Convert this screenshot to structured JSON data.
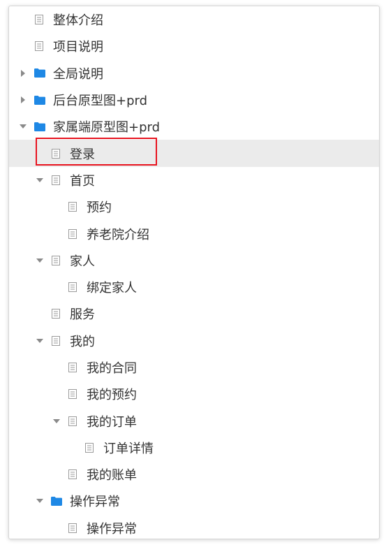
{
  "tree": {
    "items": [
      {
        "label": "整体介绍",
        "type": "page",
        "depth": 0,
        "expanded": null,
        "selected": false
      },
      {
        "label": "项目说明",
        "type": "page",
        "depth": 0,
        "expanded": null,
        "selected": false
      },
      {
        "label": "全局说明",
        "type": "folder",
        "depth": 0,
        "expanded": false,
        "selected": false
      },
      {
        "label": "后台原型图+prd",
        "type": "folder",
        "depth": 0,
        "expanded": false,
        "selected": false
      },
      {
        "label": "家属端原型图+prd",
        "type": "folder",
        "depth": 0,
        "expanded": true,
        "selected": false
      },
      {
        "label": "登录",
        "type": "page",
        "depth": 1,
        "expanded": null,
        "selected": true
      },
      {
        "label": "首页",
        "type": "page",
        "depth": 1,
        "expanded": true,
        "selected": false
      },
      {
        "label": "预约",
        "type": "page",
        "depth": 2,
        "expanded": null,
        "selected": false
      },
      {
        "label": "养老院介绍",
        "type": "page",
        "depth": 2,
        "expanded": null,
        "selected": false
      },
      {
        "label": "家人",
        "type": "page",
        "depth": 1,
        "expanded": true,
        "selected": false
      },
      {
        "label": "绑定家人",
        "type": "page",
        "depth": 2,
        "expanded": null,
        "selected": false
      },
      {
        "label": "服务",
        "type": "page",
        "depth": 1,
        "expanded": null,
        "selected": false
      },
      {
        "label": "我的",
        "type": "page",
        "depth": 1,
        "expanded": true,
        "selected": false
      },
      {
        "label": "我的合同",
        "type": "page",
        "depth": 2,
        "expanded": null,
        "selected": false
      },
      {
        "label": "我的预约",
        "type": "page",
        "depth": 2,
        "expanded": null,
        "selected": false
      },
      {
        "label": "我的订单",
        "type": "page",
        "depth": 2,
        "expanded": true,
        "selected": false
      },
      {
        "label": "订单详情",
        "type": "page",
        "depth": 3,
        "expanded": null,
        "selected": false
      },
      {
        "label": "我的账单",
        "type": "page",
        "depth": 2,
        "expanded": null,
        "selected": false
      },
      {
        "label": "操作异常",
        "type": "folder",
        "depth": 1,
        "expanded": true,
        "selected": false
      },
      {
        "label": "操作异常",
        "type": "page",
        "depth": 2,
        "expanded": null,
        "selected": false
      }
    ]
  },
  "colors": {
    "folder": "#1e88e5",
    "page_icon": "#9a9a9a",
    "text": "#333333",
    "selected_bg": "#ebebeb",
    "annotation_box": "#e8131f"
  }
}
